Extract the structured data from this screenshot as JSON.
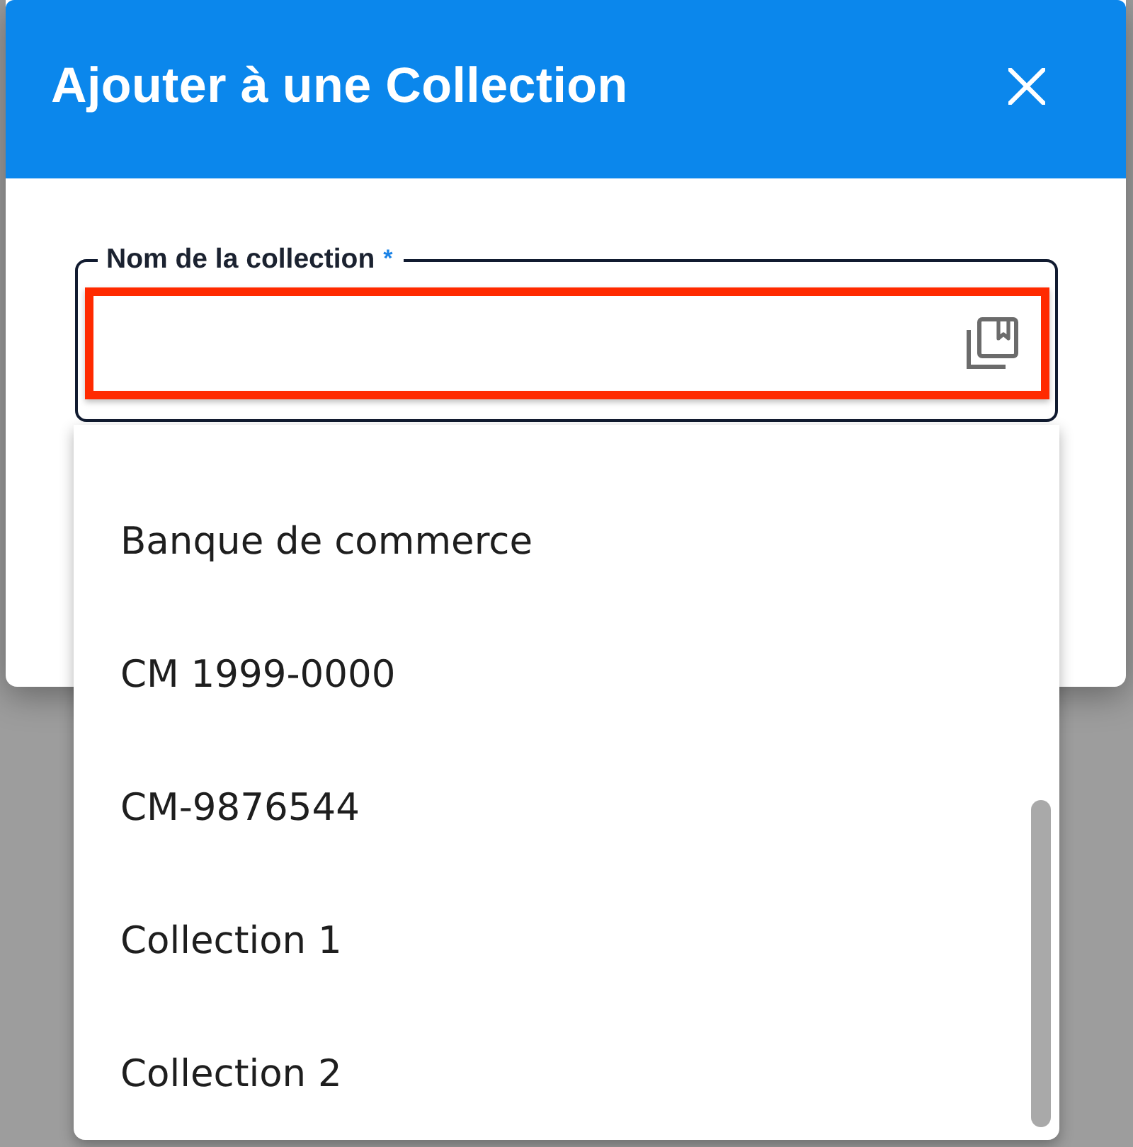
{
  "dialog": {
    "title": "Ajouter à une Collection"
  },
  "field": {
    "label": "Nom de la collection",
    "required_mark": "*",
    "highlighted": true
  },
  "dropdown": {
    "options": [
      {
        "label": "Banque de commerce",
        "selected": false
      },
      {
        "label": "CM 1999-0000",
        "selected": false
      },
      {
        "label": "CM-9876544",
        "selected": false
      },
      {
        "label": "Collection 1",
        "selected": false
      },
      {
        "label": "Collection 2",
        "selected": false
      }
    ]
  }
}
